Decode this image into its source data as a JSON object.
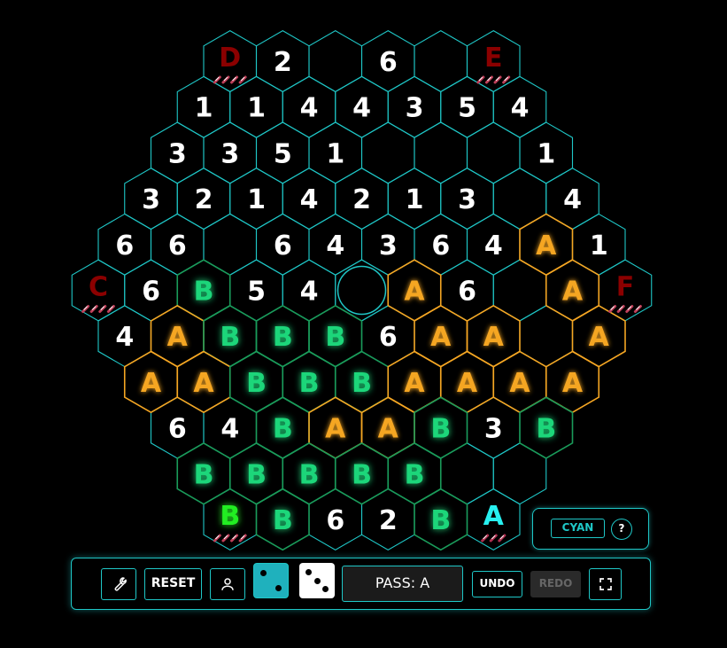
{
  "colors": {
    "background": "#000000",
    "grid": "#1fc7c7",
    "player_a": "#f5a623",
    "player_b": "#1ed67a",
    "player_b_start": "#22ee22",
    "player_cyan": "#27f0f0",
    "inactive_corner": "#8b0000",
    "number": "#ffffff",
    "die_cyan": "#1fb1bd",
    "die_white": "#ffffff"
  },
  "board": {
    "cells": [
      {
        "r": 0,
        "c": 0,
        "t": "D",
        "k": "corner",
        "ticks": 4
      },
      {
        "r": 0,
        "c": 1,
        "t": "2",
        "k": "num"
      },
      {
        "r": 0,
        "c": 2,
        "t": "",
        "k": "empty"
      },
      {
        "r": 0,
        "c": 3,
        "t": "6",
        "k": "num"
      },
      {
        "r": 0,
        "c": 4,
        "t": "",
        "k": "empty"
      },
      {
        "r": 0,
        "c": 5,
        "t": "E",
        "k": "corner",
        "ticks": 4
      },
      {
        "r": 1,
        "c": 0,
        "t": "1",
        "k": "num"
      },
      {
        "r": 1,
        "c": 1,
        "t": "1",
        "k": "num"
      },
      {
        "r": 1,
        "c": 2,
        "t": "4",
        "k": "num"
      },
      {
        "r": 1,
        "c": 3,
        "t": "4",
        "k": "num"
      },
      {
        "r": 1,
        "c": 4,
        "t": "3",
        "k": "num"
      },
      {
        "r": 1,
        "c": 5,
        "t": "5",
        "k": "num"
      },
      {
        "r": 1,
        "c": 6,
        "t": "4",
        "k": "num"
      },
      {
        "r": 2,
        "c": 0,
        "t": "3",
        "k": "num"
      },
      {
        "r": 2,
        "c": 1,
        "t": "3",
        "k": "num"
      },
      {
        "r": 2,
        "c": 2,
        "t": "5",
        "k": "num"
      },
      {
        "r": 2,
        "c": 3,
        "t": "1",
        "k": "num"
      },
      {
        "r": 2,
        "c": 4,
        "t": "",
        "k": "empty"
      },
      {
        "r": 2,
        "c": 5,
        "t": "",
        "k": "empty"
      },
      {
        "r": 2,
        "c": 6,
        "t": "",
        "k": "empty"
      },
      {
        "r": 2,
        "c": 7,
        "t": "1",
        "k": "num"
      },
      {
        "r": 3,
        "c": 0,
        "t": "3",
        "k": "num"
      },
      {
        "r": 3,
        "c": 1,
        "t": "2",
        "k": "num"
      },
      {
        "r": 3,
        "c": 2,
        "t": "1",
        "k": "num"
      },
      {
        "r": 3,
        "c": 3,
        "t": "4",
        "k": "num"
      },
      {
        "r": 3,
        "c": 4,
        "t": "2",
        "k": "num"
      },
      {
        "r": 3,
        "c": 5,
        "t": "1",
        "k": "num"
      },
      {
        "r": 3,
        "c": 6,
        "t": "3",
        "k": "num"
      },
      {
        "r": 3,
        "c": 7,
        "t": "",
        "k": "empty"
      },
      {
        "r": 3,
        "c": 8,
        "t": "4",
        "k": "num"
      },
      {
        "r": 4,
        "c": 0,
        "t": "6",
        "k": "num"
      },
      {
        "r": 4,
        "c": 1,
        "t": "6",
        "k": "num"
      },
      {
        "r": 4,
        "c": 2,
        "t": "",
        "k": "empty"
      },
      {
        "r": 4,
        "c": 3,
        "t": "6",
        "k": "num"
      },
      {
        "r": 4,
        "c": 4,
        "t": "4",
        "k": "num"
      },
      {
        "r": 4,
        "c": 5,
        "t": "3",
        "k": "num"
      },
      {
        "r": 4,
        "c": 6,
        "t": "6",
        "k": "num"
      },
      {
        "r": 4,
        "c": 7,
        "t": "4",
        "k": "num"
      },
      {
        "r": 4,
        "c": 8,
        "t": "A",
        "k": "A"
      },
      {
        "r": 4,
        "c": 9,
        "t": "1",
        "k": "num"
      },
      {
        "r": 5,
        "c": 0,
        "t": "C",
        "k": "corner",
        "ticks": 4
      },
      {
        "r": 5,
        "c": 1,
        "t": "6",
        "k": "num"
      },
      {
        "r": 5,
        "c": 2,
        "t": "B",
        "k": "B"
      },
      {
        "r": 5,
        "c": 3,
        "t": "5",
        "k": "num"
      },
      {
        "r": 5,
        "c": 4,
        "t": "4",
        "k": "num"
      },
      {
        "r": 5,
        "c": 5,
        "t": "",
        "k": "center"
      },
      {
        "r": 5,
        "c": 6,
        "t": "A",
        "k": "A"
      },
      {
        "r": 5,
        "c": 7,
        "t": "6",
        "k": "num"
      },
      {
        "r": 5,
        "c": 8,
        "t": "",
        "k": "empty"
      },
      {
        "r": 5,
        "c": 9,
        "t": "A",
        "k": "A"
      },
      {
        "r": 5,
        "c": 10,
        "t": "F",
        "k": "corner",
        "ticks": 4
      },
      {
        "r": 6,
        "c": 0,
        "t": "4",
        "k": "num"
      },
      {
        "r": 6,
        "c": 1,
        "t": "A",
        "k": "A"
      },
      {
        "r": 6,
        "c": 2,
        "t": "B",
        "k": "B"
      },
      {
        "r": 6,
        "c": 3,
        "t": "B",
        "k": "B"
      },
      {
        "r": 6,
        "c": 4,
        "t": "B",
        "k": "B"
      },
      {
        "r": 6,
        "c": 5,
        "t": "6",
        "k": "num"
      },
      {
        "r": 6,
        "c": 6,
        "t": "A",
        "k": "A"
      },
      {
        "r": 6,
        "c": 7,
        "t": "A",
        "k": "A"
      },
      {
        "r": 6,
        "c": 8,
        "t": "",
        "k": "empty"
      },
      {
        "r": 6,
        "c": 9,
        "t": "A",
        "k": "A"
      },
      {
        "r": 7,
        "c": 0,
        "t": "A",
        "k": "A"
      },
      {
        "r": 7,
        "c": 1,
        "t": "A",
        "k": "A"
      },
      {
        "r": 7,
        "c": 2,
        "t": "B",
        "k": "B"
      },
      {
        "r": 7,
        "c": 3,
        "t": "B",
        "k": "B"
      },
      {
        "r": 7,
        "c": 4,
        "t": "B",
        "k": "B"
      },
      {
        "r": 7,
        "c": 5,
        "t": "A",
        "k": "A"
      },
      {
        "r": 7,
        "c": 6,
        "t": "A",
        "k": "A"
      },
      {
        "r": 7,
        "c": 7,
        "t": "A",
        "k": "A"
      },
      {
        "r": 7,
        "c": 8,
        "t": "A",
        "k": "A"
      },
      {
        "r": 8,
        "c": 0,
        "t": "6",
        "k": "num"
      },
      {
        "r": 8,
        "c": 1,
        "t": "4",
        "k": "num"
      },
      {
        "r": 8,
        "c": 2,
        "t": "B",
        "k": "B"
      },
      {
        "r": 8,
        "c": 3,
        "t": "A",
        "k": "A"
      },
      {
        "r": 8,
        "c": 4,
        "t": "A",
        "k": "A"
      },
      {
        "r": 8,
        "c": 5,
        "t": "B",
        "k": "B"
      },
      {
        "r": 8,
        "c": 6,
        "t": "3",
        "k": "num"
      },
      {
        "r": 8,
        "c": 7,
        "t": "B",
        "k": "B"
      },
      {
        "r": 9,
        "c": 0,
        "t": "B",
        "k": "B"
      },
      {
        "r": 9,
        "c": 1,
        "t": "B",
        "k": "B"
      },
      {
        "r": 9,
        "c": 2,
        "t": "B",
        "k": "B"
      },
      {
        "r": 9,
        "c": 3,
        "t": "B",
        "k": "B"
      },
      {
        "r": 9,
        "c": 4,
        "t": "B",
        "k": "B"
      },
      {
        "r": 9,
        "c": 5,
        "t": "",
        "k": "empty"
      },
      {
        "r": 9,
        "c": 6,
        "t": "",
        "k": "empty"
      },
      {
        "r": 10,
        "c": 0,
        "t": "B",
        "k": "Bstart",
        "ticks": 4
      },
      {
        "r": 10,
        "c": 1,
        "t": "B",
        "k": "B"
      },
      {
        "r": 10,
        "c": 2,
        "t": "6",
        "k": "num"
      },
      {
        "r": 10,
        "c": 3,
        "t": "2",
        "k": "num"
      },
      {
        "r": 10,
        "c": 4,
        "t": "B",
        "k": "B"
      },
      {
        "r": 10,
        "c": 5,
        "t": "A",
        "k": "Astart",
        "ticks": 3
      }
    ]
  },
  "player_panel": {
    "player_label": "CYAN",
    "help_label": "?"
  },
  "toolbar": {
    "settings_icon": "wrench-icon",
    "reset_label": "RESET",
    "player_mode_icon": "person-icon",
    "die_1": {
      "value": 2,
      "color": "cyan"
    },
    "die_2": {
      "value": 3,
      "color": "white"
    },
    "pass_label": "PASS: A",
    "undo_label": "UNDO",
    "redo_label": "REDO",
    "redo_enabled": false,
    "fullscreen_icon": "fullscreen-icon"
  }
}
